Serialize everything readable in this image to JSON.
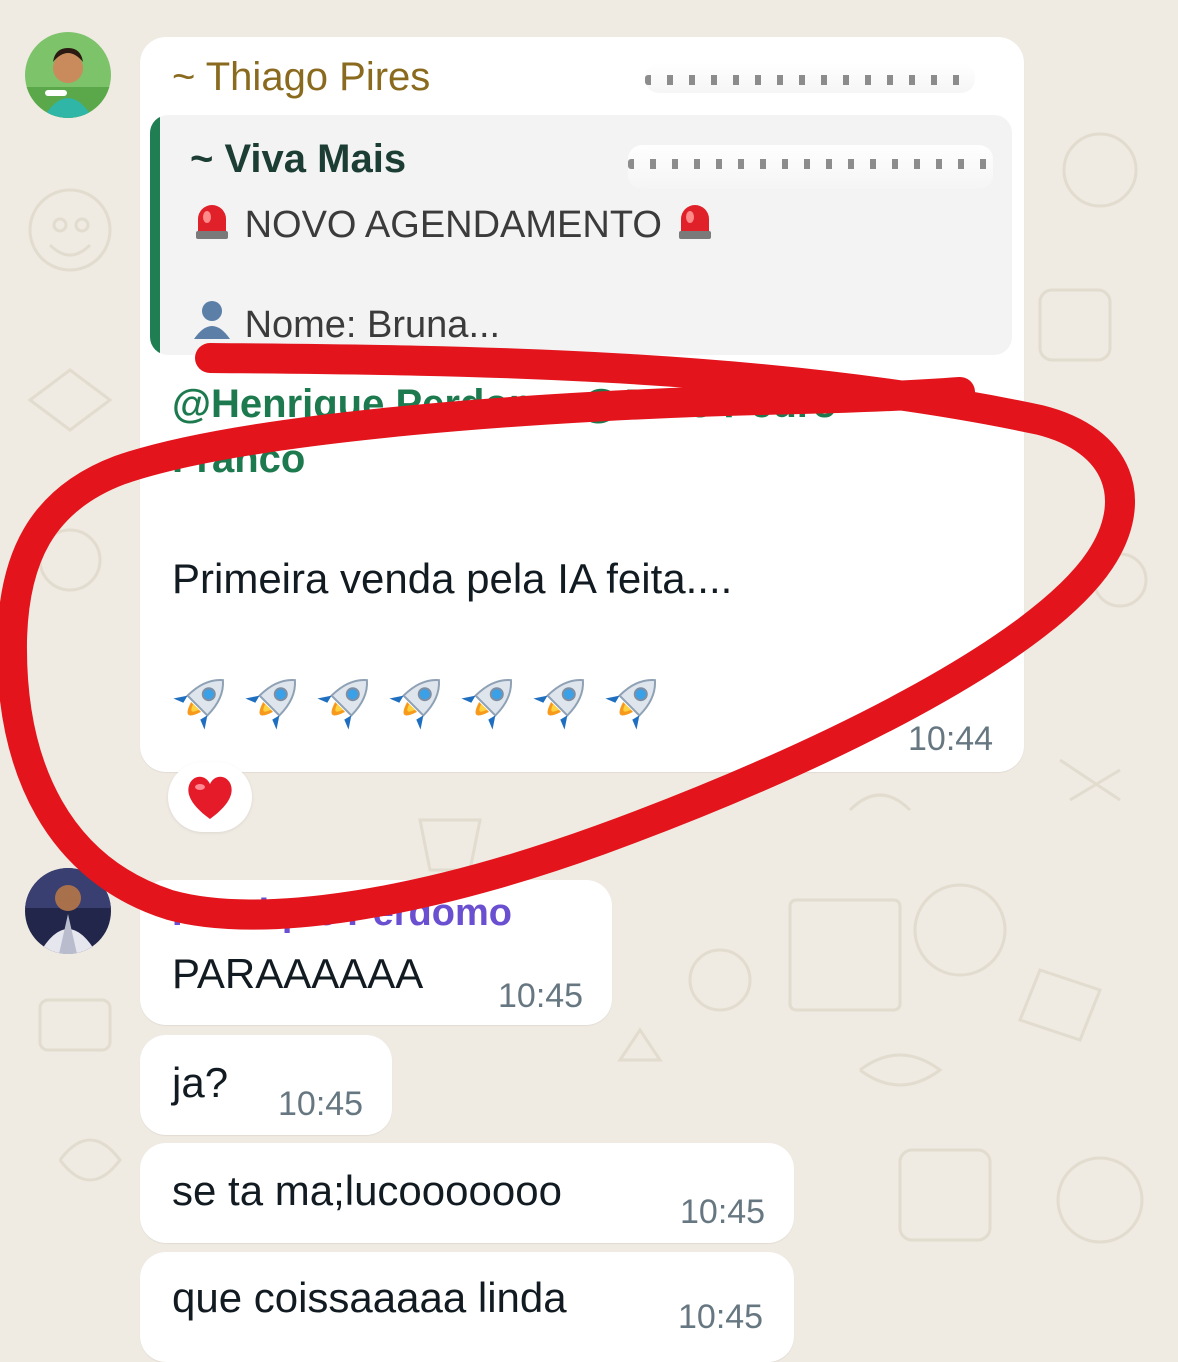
{
  "chat": {
    "messages": [
      {
        "sender": "~ Thiago Pires",
        "quote": {
          "sender": "~ Viva Mais",
          "line1": "NOVO AGENDAMENTO",
          "line2": "Nome: Bruna..."
        },
        "mention_line1": "@Henrique Perdomo @João Pedro",
        "mention_line2": "Franco",
        "text": "Primeira venda pela IA feita....",
        "emoji": "rocket x7",
        "time": "10:44",
        "reaction": "heart"
      },
      {
        "sender": "Henrique Perdomo",
        "text": "PARAAAAAA",
        "time": "10:45"
      },
      {
        "text": "ja?",
        "time": "10:45"
      },
      {
        "text": "se ta ma;lucooooooo",
        "time": "10:45"
      },
      {
        "text": "que coissaaaaa linda",
        "time": "10:45"
      }
    ]
  },
  "colors": {
    "background": "#efeae2",
    "sender1": "#8a6a1e",
    "sender2": "#6a4fd0",
    "quote_bar": "#1f7f53",
    "mention": "#1d7a4f",
    "annotation": "#e3141b"
  }
}
